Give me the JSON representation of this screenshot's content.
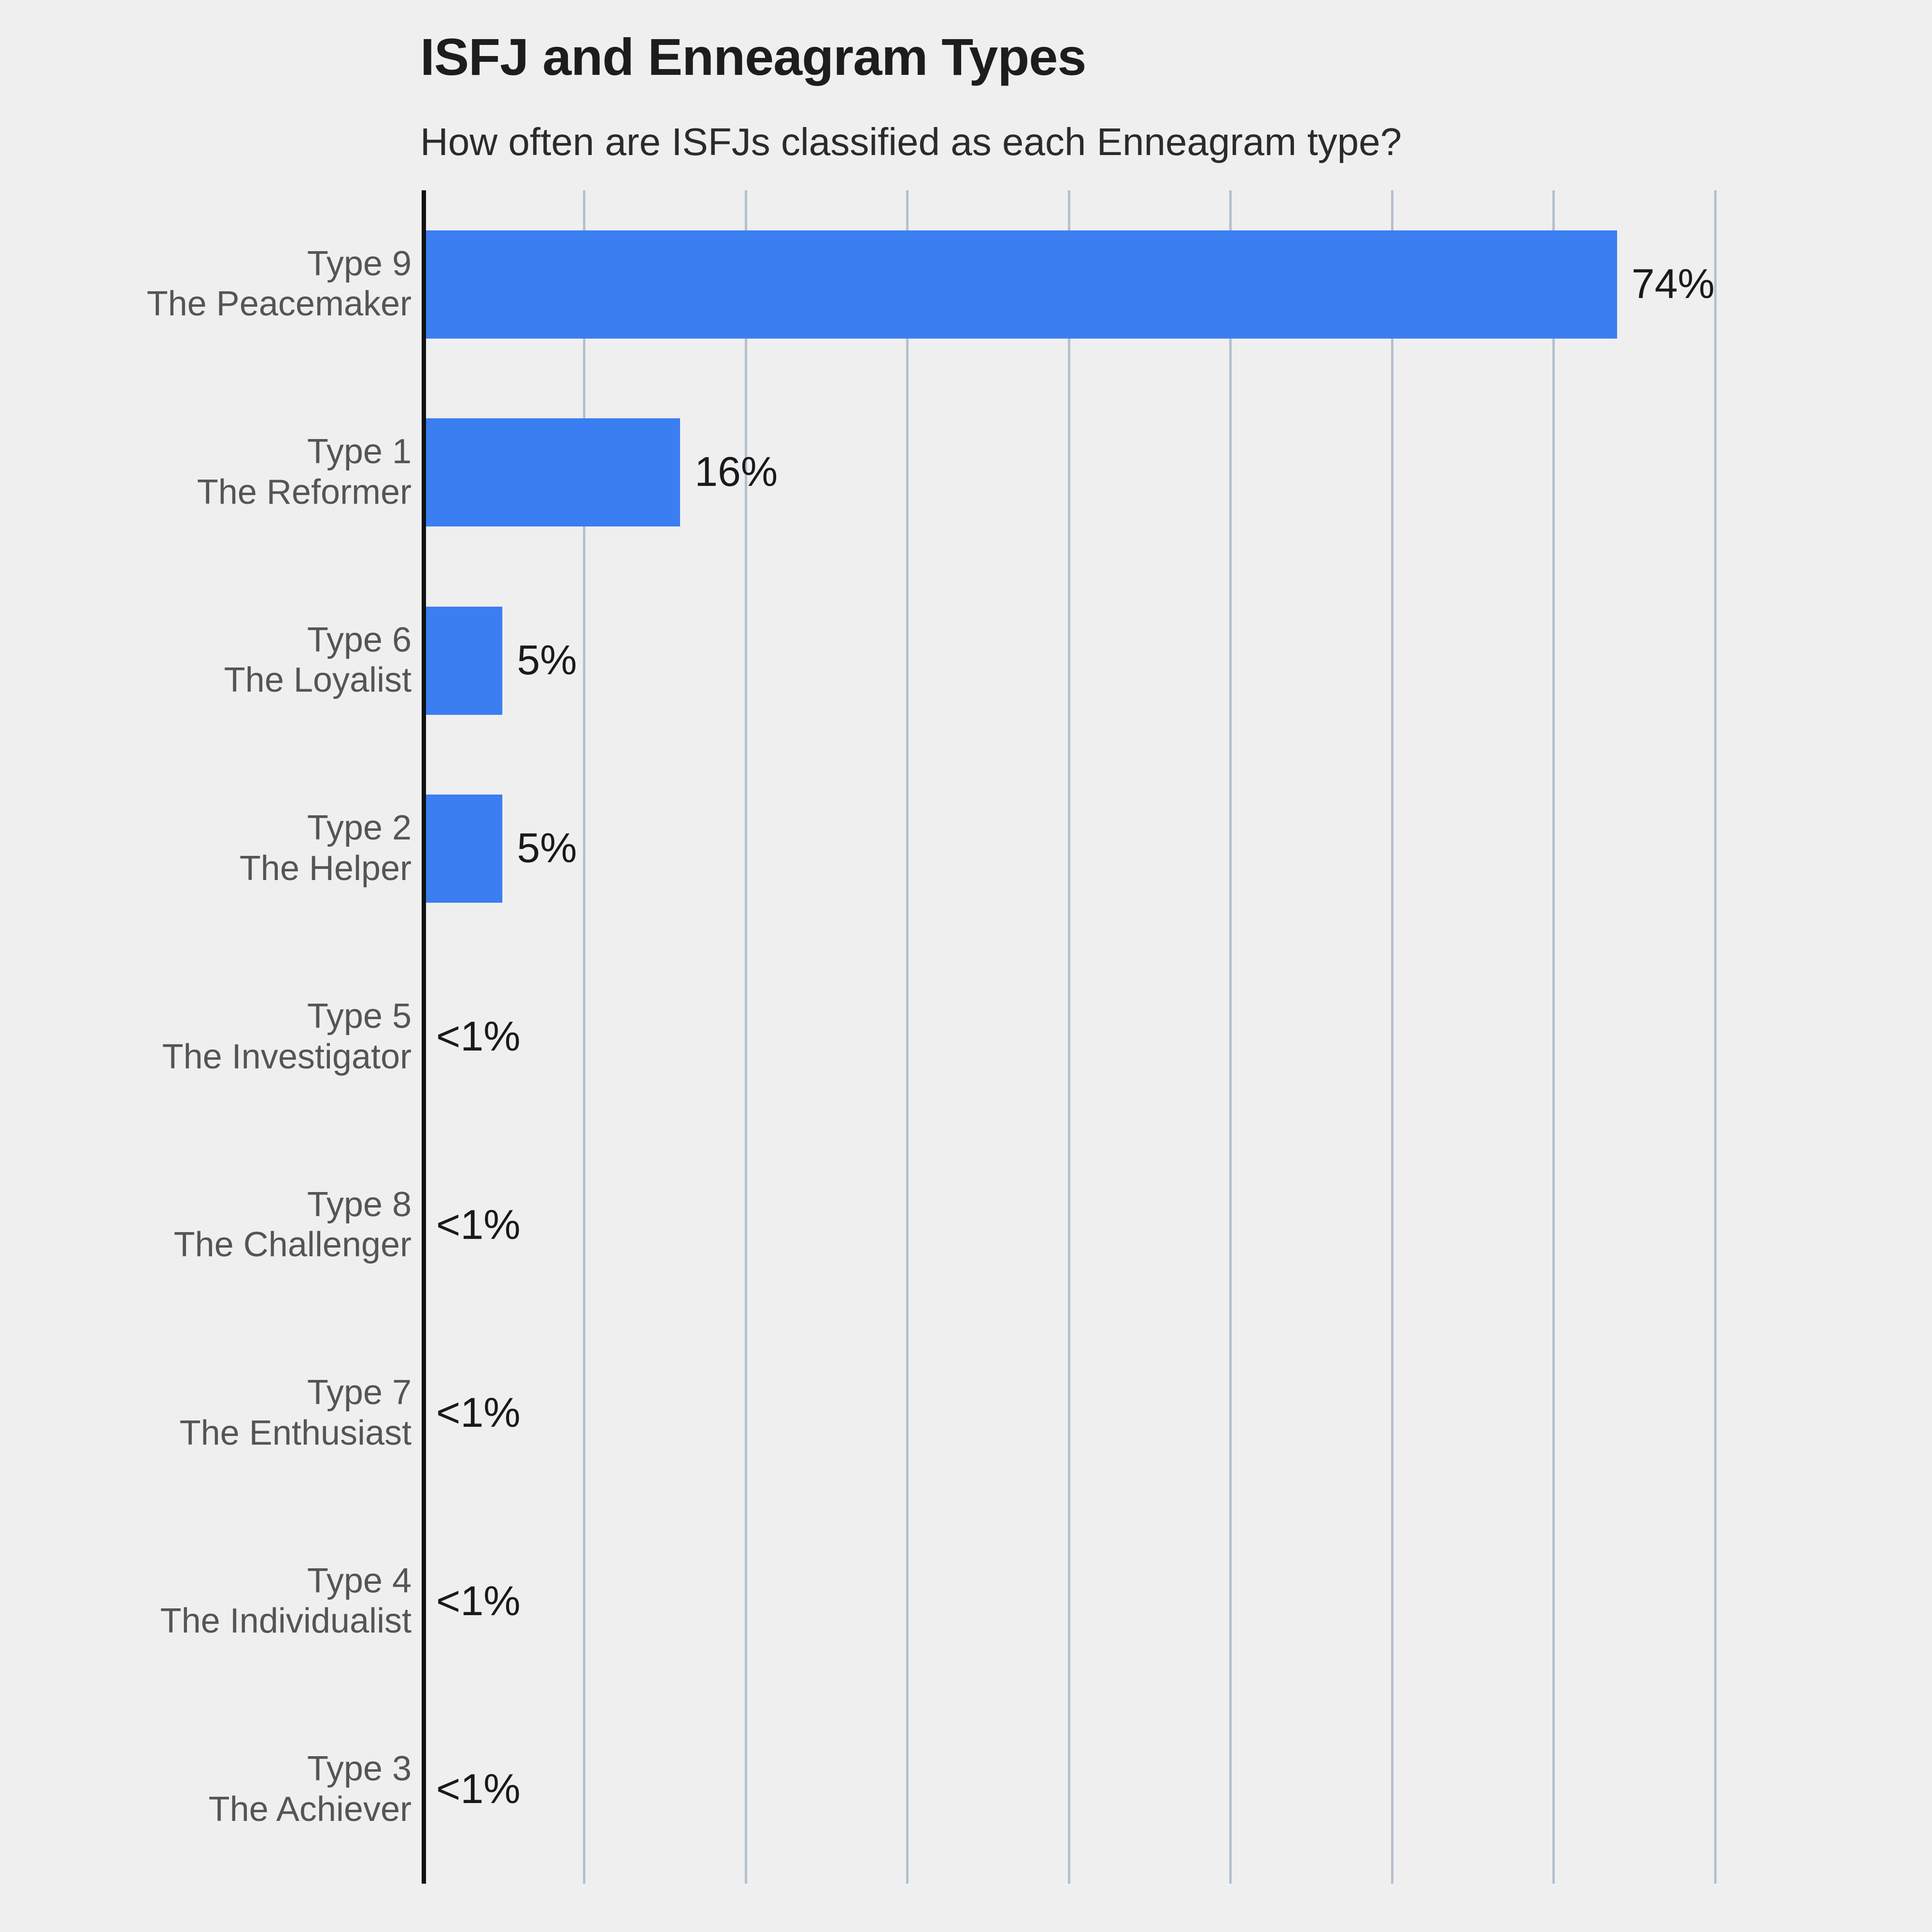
{
  "chart_data": {
    "type": "bar",
    "orientation": "horizontal",
    "title": "ISFJ and Enneagram Types",
    "subtitle": "How often are ISFJs classified as each Enneagram type?",
    "xlabel": "",
    "ylabel": "",
    "xlim": [
      0,
      90
    ],
    "grid": "vertical",
    "gridline_values": [
      10,
      20,
      30,
      40,
      50,
      60,
      70,
      80
    ],
    "legend": "none",
    "bar_color": "#3b7ef2",
    "background_color": "#efefef",
    "axis_color": "#111111",
    "gridline_color": "#b3c1cd",
    "label_color": "#555555",
    "value_label_color": "#1a1a1a",
    "categories": [
      "Type 9 The Peacemaker",
      "Type 1 The Reformer",
      "Type 6 The Loyalist",
      "Type 2 The Helper",
      "Type 5 The Investigator",
      "Type 8 The Challenger",
      "Type 7 The Enthusiast",
      "Type 4 The Individualist",
      "Type 3 The Achiever"
    ],
    "values": [
      74,
      16,
      5,
      5,
      0.5,
      0.5,
      0.5,
      0.5,
      0.5
    ],
    "value_labels": [
      "74%",
      "16%",
      "5%",
      "5%",
      "<1%",
      "<1%",
      "<1%",
      "<1%",
      "<1%"
    ],
    "rows": [
      {
        "type": "Type 9",
        "name": "The Peacemaker",
        "value": 74,
        "value_label": "74%"
      },
      {
        "type": "Type 1",
        "name": "The Reformer",
        "value": 16,
        "value_label": "16%"
      },
      {
        "type": "Type 6",
        "name": "The Loyalist",
        "value": 5,
        "value_label": "5%"
      },
      {
        "type": "Type 2",
        "name": "The Helper",
        "value": 5,
        "value_label": "5%"
      },
      {
        "type": "Type 5",
        "name": "The Investigator",
        "value": 0,
        "value_label": "<1%"
      },
      {
        "type": "Type 8",
        "name": "The Challenger",
        "value": 0,
        "value_label": "<1%"
      },
      {
        "type": "Type 7",
        "name": "The Enthusiast",
        "value": 0,
        "value_label": "<1%"
      },
      {
        "type": "Type 4",
        "name": "The Individualist",
        "value": 0,
        "value_label": "<1%"
      },
      {
        "type": "Type 3",
        "name": "The Achiever",
        "value": 0,
        "value_label": "<1%"
      }
    ]
  }
}
